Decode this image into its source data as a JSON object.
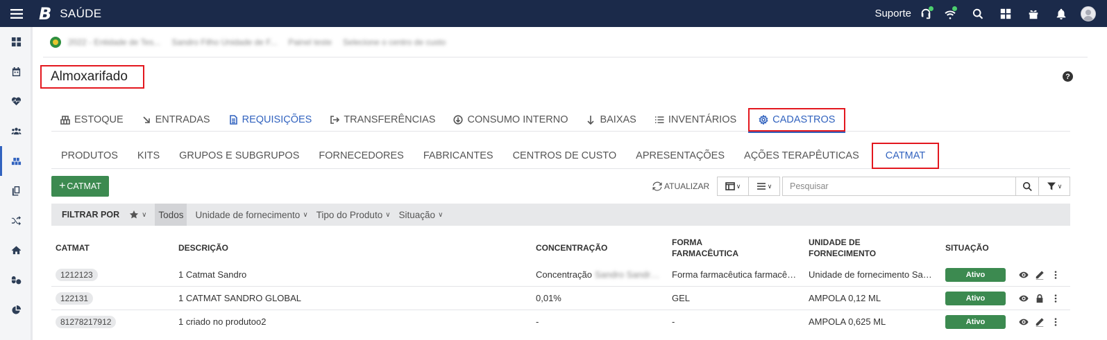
{
  "app": {
    "logo": "B",
    "title": "SAÚDE",
    "support_label": "Suporte"
  },
  "breadcrumb": [
    "2022 - Entidade de Tes...",
    "Sandro Filho Unidade de F...",
    "Painel teste",
    "Selecione o centro de custo"
  ],
  "page": {
    "title": "Almoxarifado",
    "help": "?"
  },
  "main_tabs": [
    "ESTOQUE",
    "ENTRADAS",
    "REQUISIÇÕES",
    "TRANSFERÊNCIAS",
    "CONSUMO INTERNO",
    "BAIXAS",
    "INVENTÁRIOS",
    "CADASTROS"
  ],
  "sub_tabs": [
    "PRODUTOS",
    "KITS",
    "GRUPOS E SUBGRUPOS",
    "FORNECEDORES",
    "FABRICANTES",
    "CENTROS DE CUSTO",
    "APRESENTAÇÕES",
    "AÇÕES TERAPÊUTICAS",
    "CATMAT"
  ],
  "toolbar": {
    "add_plus": "+",
    "add_label": "CATMAT",
    "refresh_label": "ATUALIZAR",
    "search_placeholder": "Pesquisar"
  },
  "filter": {
    "label": "FILTRAR POR",
    "todos": "Todos",
    "dropdowns": [
      "Unidade de fornecimento",
      "Tipo do Produto",
      "Situação"
    ]
  },
  "table": {
    "headers": {
      "catmat": "CATMAT",
      "descricao": "DESCRIÇÃO",
      "concentracao": "CONCENTRAÇÃO",
      "forma_1": "FORMA",
      "forma_2": "FARMACÊUTICA",
      "unidade_1": "UNIDADE DE",
      "unidade_2": "FORNECIMENTO",
      "situacao": "SITUAÇÃO"
    },
    "rows": [
      {
        "code": "1212123",
        "descricao": "1 Catmat Sandro",
        "concentracao": "Concentração",
        "concentracao_hidden": "Sandro Sandro...",
        "forma": "Forma farmacêutica farmacêutica",
        "unidade": "Unidade de fornecimento Sandro",
        "situacao": "Ativo"
      },
      {
        "code": "122131",
        "descricao": "1 CATMAT SANDRO GLOBAL",
        "concentracao": "0,01%",
        "concentracao_hidden": "",
        "forma": "GEL",
        "unidade": "AMPOLA 0,12 ML",
        "situacao": "Ativo"
      },
      {
        "code": "81278217912",
        "descricao": "1 criado no produtoo2",
        "concentracao": "-",
        "concentracao_hidden": "",
        "forma": "-",
        "unidade": "AMPOLA 0,625 ML",
        "situacao": "Ativo"
      }
    ]
  },
  "colors": {
    "topbar": "#1b2a4a",
    "accent": "#3263bf",
    "success": "#3c8a50",
    "highlight_border": "#e3171e"
  }
}
